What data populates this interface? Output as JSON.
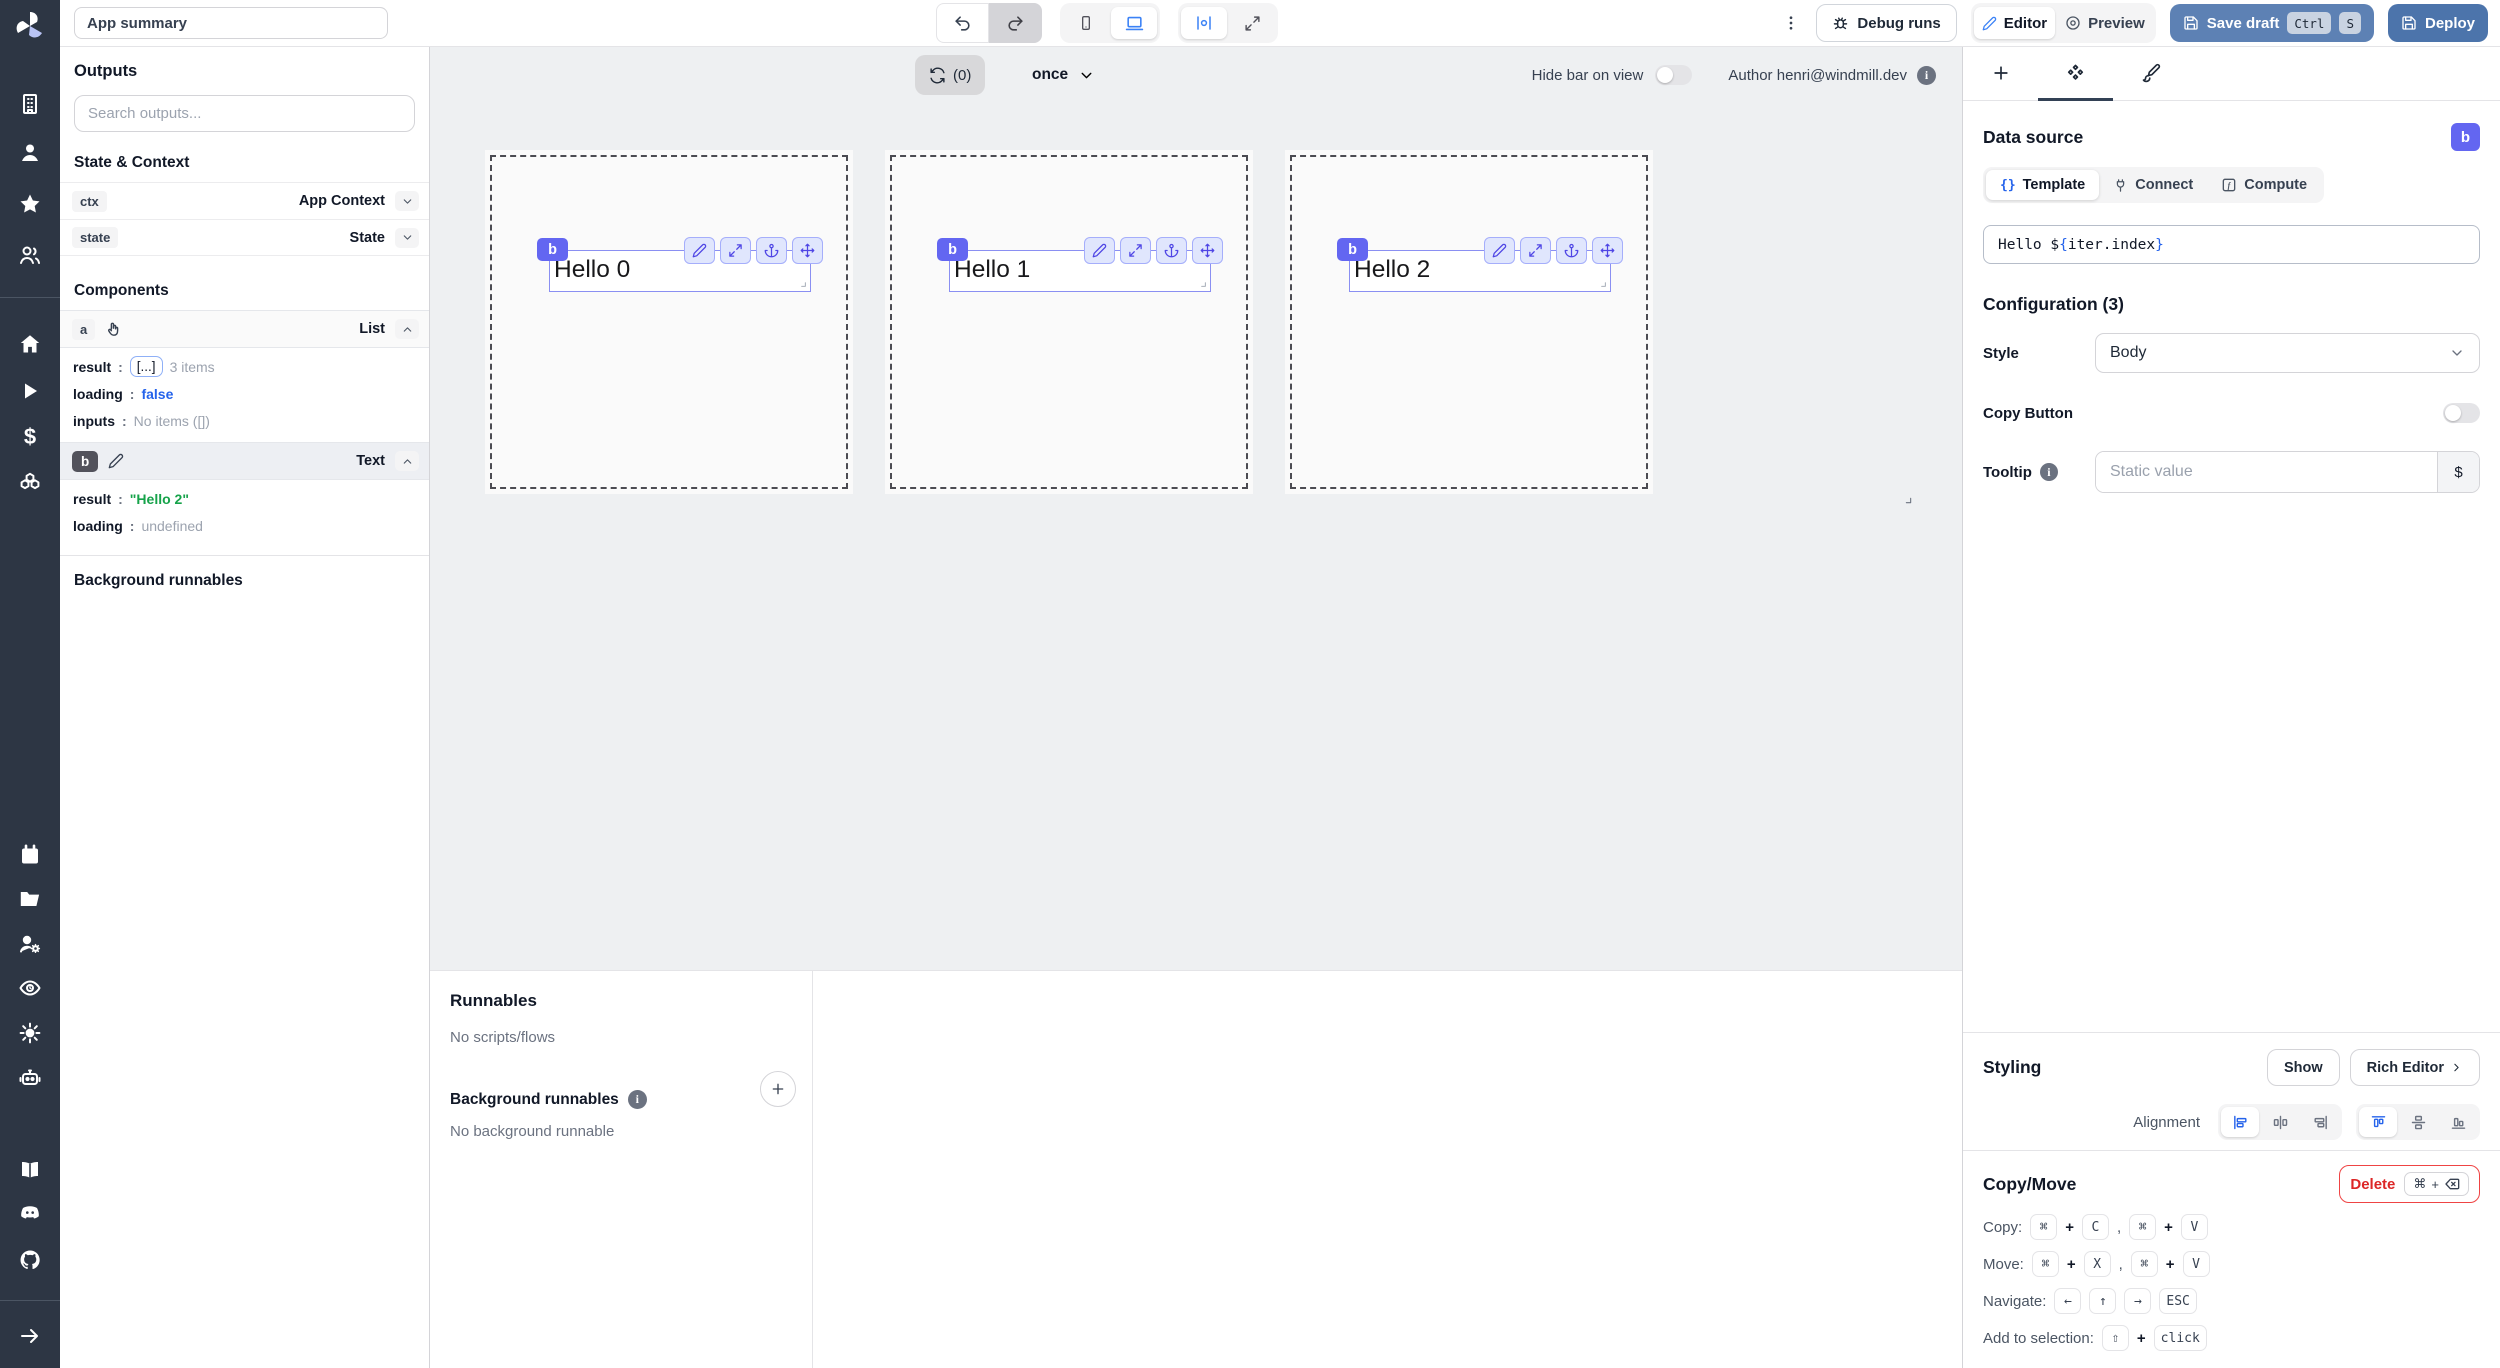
{
  "colors": {
    "accent_indigo": "#6366f1",
    "save_button_blue": "#5d81b4",
    "deploy_button_blue": "#4c74ab",
    "delete_red": "#dc2626",
    "value_blue": "#2563eb",
    "value_green": "#16a34a",
    "rail_background": "#2d3644"
  },
  "topbar": {
    "app_summary": "App summary",
    "debug_runs": "Debug runs",
    "editor": "Editor",
    "preview": "Preview",
    "save_draft": "Save draft",
    "deploy": "Deploy",
    "kbd_ctrl": "Ctrl",
    "kbd_s": "S"
  },
  "outputs": {
    "title": "Outputs",
    "search_placeholder": "Search outputs...",
    "state_context_title": "State & Context",
    "ctx_key": "ctx",
    "ctx_type": "App Context",
    "state_key": "state",
    "state_type": "State",
    "components_title": "Components",
    "comp_a": {
      "id": "a",
      "type": "List",
      "result_key": "result",
      "colon": ":",
      "result_badge": "[...]",
      "result_note": "3 items",
      "loading_key": "loading",
      "loading_value": "false",
      "inputs_key": "inputs",
      "inputs_value": "No items ([])"
    },
    "comp_b": {
      "id": "b",
      "type": "Text",
      "result_key": "result",
      "colon": ":",
      "result_value": "\"Hello 2\"",
      "loading_key": "loading",
      "loading_value": "undefined"
    },
    "background_title": "Background runnables"
  },
  "canvas": {
    "loop_count": "(0)",
    "loop_mode": "once",
    "hide_bar": "Hide bar on view",
    "author": "Author henri@windmill.dev",
    "cells": [
      {
        "badge": "b",
        "text": "Hello 0"
      },
      {
        "badge": "b",
        "text": "Hello 1"
      },
      {
        "badge": "b",
        "text": "Hello 2"
      }
    ]
  },
  "runnables": {
    "title": "Runnables",
    "empty": "No scripts/flows",
    "bg_title": "Background runnables",
    "bg_empty": "No background runnable"
  },
  "inspector": {
    "data_source_title": "Data source",
    "badge": "b",
    "template_icon": "{}",
    "tab_template": "Template",
    "tab_connect": "Connect",
    "tab_compute": "Compute",
    "expr_prefix": "Hello $",
    "expr_open": "{",
    "expr_body": "iter.index",
    "expr_close": "}",
    "config_title": "Configuration (3)",
    "style_label": "Style",
    "style_value": "Body",
    "copy_button_label": "Copy Button",
    "tooltip_label": "Tooltip",
    "tooltip_placeholder": "Static value",
    "tooltip_suffix": "$",
    "styling_title": "Styling",
    "show_btn": "Show",
    "rich_editor_btn": "Rich Editor",
    "alignment_label": "Alignment",
    "copymove_title": "Copy/Move",
    "delete_btn": "Delete",
    "copy_label": "Copy:",
    "move_label": "Move:",
    "navigate_label": "Navigate:",
    "add_label": "Add to selection:",
    "k_cmd": "⌘",
    "k_plus": "+",
    "k_comma": ",",
    "k_c": "C",
    "k_v": "V",
    "k_x": "X",
    "k_left": "←",
    "k_up": "↑",
    "k_right": "→",
    "k_esc": "ESC",
    "k_shift": "⇧",
    "k_click": "click"
  }
}
